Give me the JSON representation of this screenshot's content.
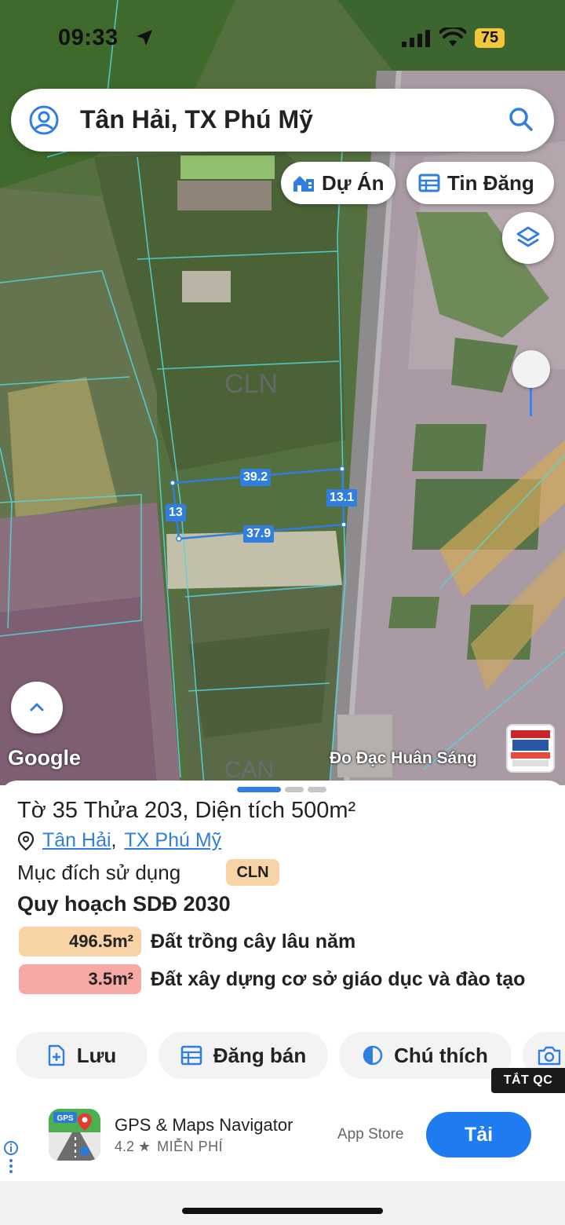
{
  "status_bar": {
    "time": "09:33",
    "battery": "75"
  },
  "search": {
    "title": "Tân Hải, TX Phú Mỹ"
  },
  "map": {
    "chips": {
      "project": "Dự Án",
      "listing": "Tin Đăng"
    },
    "land_labels": {
      "cln": "CLN",
      "bottom": "CAN"
    },
    "dimensions": {
      "top": "39.2",
      "right": "13.1",
      "left": "13",
      "bottom": "37.9"
    },
    "attribution": "Google",
    "watermark": "Đo Đạc Huân Sáng"
  },
  "parcel": {
    "title": "Tờ 35 Thửa 203, Diện tích 500m²",
    "ward": "Tân Hải",
    "district": "TX Phú Mỹ",
    "purpose_label": "Mục đích sử dụng",
    "purpose_code": "CLN",
    "plan_title": "Quy hoạch SDĐ 2030",
    "plan_rows": [
      {
        "area": "496.5m²",
        "desc": "Đất trồng cây lâu năm",
        "color": "#f8d3a5"
      },
      {
        "area": "3.5m²",
        "desc": "Đất xây dựng cơ sở giáo dục và đào tạo",
        "color": "#f6a8a4"
      }
    ]
  },
  "actions": {
    "save": "Lưu",
    "post": "Đăng bán",
    "legend": "Chú thích"
  },
  "ads_off": "TẮT QC",
  "ad": {
    "name": "GPS & Maps Navigator",
    "rating": "4.2 ★",
    "price": "MIỄN PHÍ",
    "store": "App Store",
    "get": "Tải"
  },
  "colors": {
    "accent": "#2f7ee0",
    "parcel_line": "#2f7ee0"
  }
}
